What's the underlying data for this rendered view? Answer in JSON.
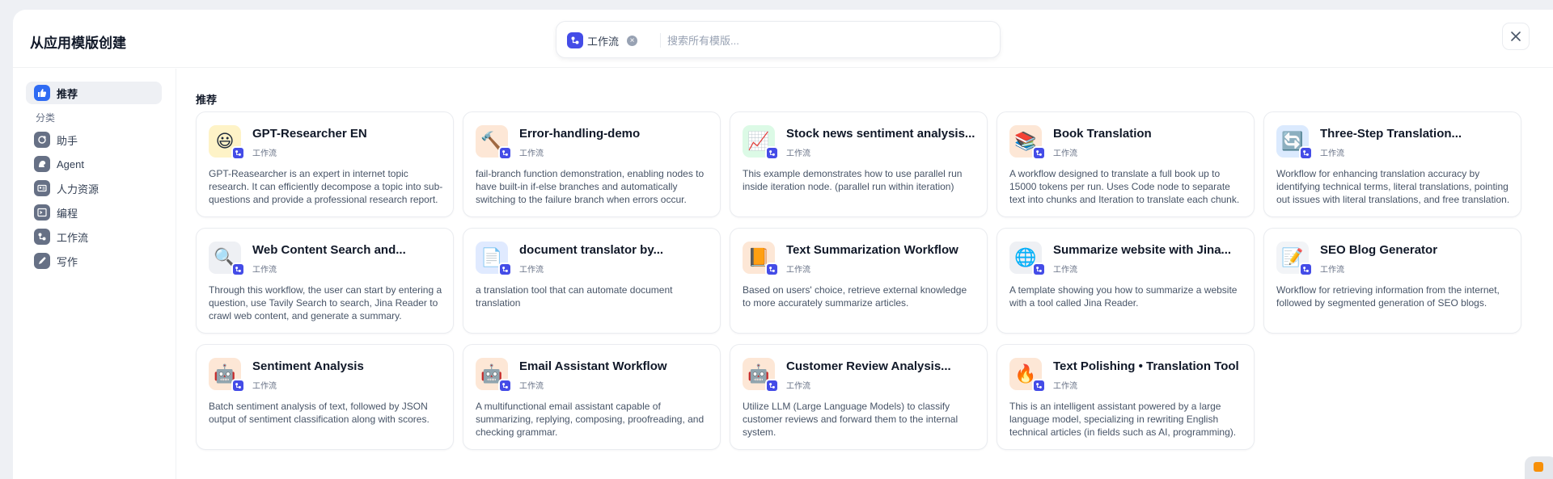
{
  "header": {
    "title": "从应用模版创建",
    "filter_chip": "工作流",
    "search_placeholder": "搜索所有模版..."
  },
  "sidebar": {
    "recommended": "推荐",
    "section_label": "分类",
    "items": [
      {
        "label": "助手",
        "icon": "assistant-icon"
      },
      {
        "label": "Agent",
        "icon": "agent-icon"
      },
      {
        "label": "人力资源",
        "icon": "hr-icon"
      },
      {
        "label": "编程",
        "icon": "terminal-icon"
      },
      {
        "label": "工作流",
        "icon": "workflow-icon"
      },
      {
        "label": "写作",
        "icon": "pen-icon"
      }
    ]
  },
  "main": {
    "section_title": "推荐",
    "cards": [
      {
        "name": "GPT-Researcher EN",
        "type": "工作流",
        "icon": "😃",
        "icon_bg": "#fef3c7",
        "desc": "GPT-Reasearcher is an expert in internet topic research. It can efficiently decompose a topic into sub-questions and provide a professional research report."
      },
      {
        "name": "Error-handling-demo",
        "type": "工作流",
        "icon": "🔨",
        "icon_bg": "#fde7d6",
        "desc": "fail-branch function demonstration, enabling nodes to have built-in if-else branches and automatically switching to the failure branch when errors occur."
      },
      {
        "name": "Stock news sentiment analysis...",
        "type": "工作流",
        "icon": "📈",
        "icon_bg": "#dcfae6",
        "desc": "This example demonstrates how to use parallel run inside iteration node. (parallel run within iteration)"
      },
      {
        "name": "Book Translation",
        "type": "工作流",
        "icon": "📚",
        "icon_bg": "#fde7d6",
        "desc": "A workflow designed to translate a full book up to 15000 tokens per run. Uses Code node to separate text into chunks and Iteration to translate each chunk."
      },
      {
        "name": "Three-Step Translation...",
        "type": "工作流",
        "icon": "🔄",
        "icon_bg": "#dbeafe",
        "desc": "Workflow for enhancing translation accuracy by identifying technical terms, literal translations, pointing out issues with literal translations, and free translation."
      },
      {
        "name": "Web Content Search and...",
        "type": "工作流",
        "icon": "🔍",
        "icon_bg": "#eef0f4",
        "desc": "Through this workflow, the user can start by entering a question, use Tavily Search to search, Jina Reader to crawl web content, and generate a summary."
      },
      {
        "name": "document translator by...",
        "type": "工作流",
        "icon": "📄",
        "icon_bg": "#e0eaff",
        "desc": "a translation tool that can automate document translation"
      },
      {
        "name": "Text Summarization Workflow",
        "type": "工作流",
        "icon": "📙",
        "icon_bg": "#fde7d6",
        "desc": "Based on users' choice, retrieve external knowledge to more accurately summarize articles."
      },
      {
        "name": "Summarize website with Jina...",
        "type": "工作流",
        "icon": "🌐",
        "icon_bg": "#eef0f4",
        "desc": "A template showing you how to summarize a website with a tool called Jina Reader."
      },
      {
        "name": "SEO Blog Generator",
        "type": "工作流",
        "icon": "📝",
        "icon_bg": "#f2f4f7",
        "desc": "Workflow for retrieving information from the internet, followed by segmented generation of SEO blogs."
      },
      {
        "name": "Sentiment Analysis",
        "type": "工作流",
        "icon": "🤖",
        "icon_bg": "#fde7d6",
        "desc": "Batch sentiment analysis of text, followed by JSON output of sentiment classification along with scores."
      },
      {
        "name": "Email Assistant Workflow",
        "type": "工作流",
        "icon": "🤖",
        "icon_bg": "#fde7d6",
        "desc": "A multifunctional email assistant capable of summarizing, replying, composing, proofreading, and checking grammar."
      },
      {
        "name": "Customer Review Analysis...",
        "type": "工作流",
        "icon": "🤖",
        "icon_bg": "#fde7d6",
        "desc": "Utilize LLM (Large Language Models) to classify customer reviews and forward them to the internal system."
      },
      {
        "name": "Text Polishing • Translation Tool",
        "type": "工作流",
        "icon": "🔥",
        "icon_bg": "#fde7d6",
        "desc": "This is an intelligent assistant powered by a large language model, specializing in rewriting English technical articles (in fields such as AI, programming)."
      }
    ]
  }
}
